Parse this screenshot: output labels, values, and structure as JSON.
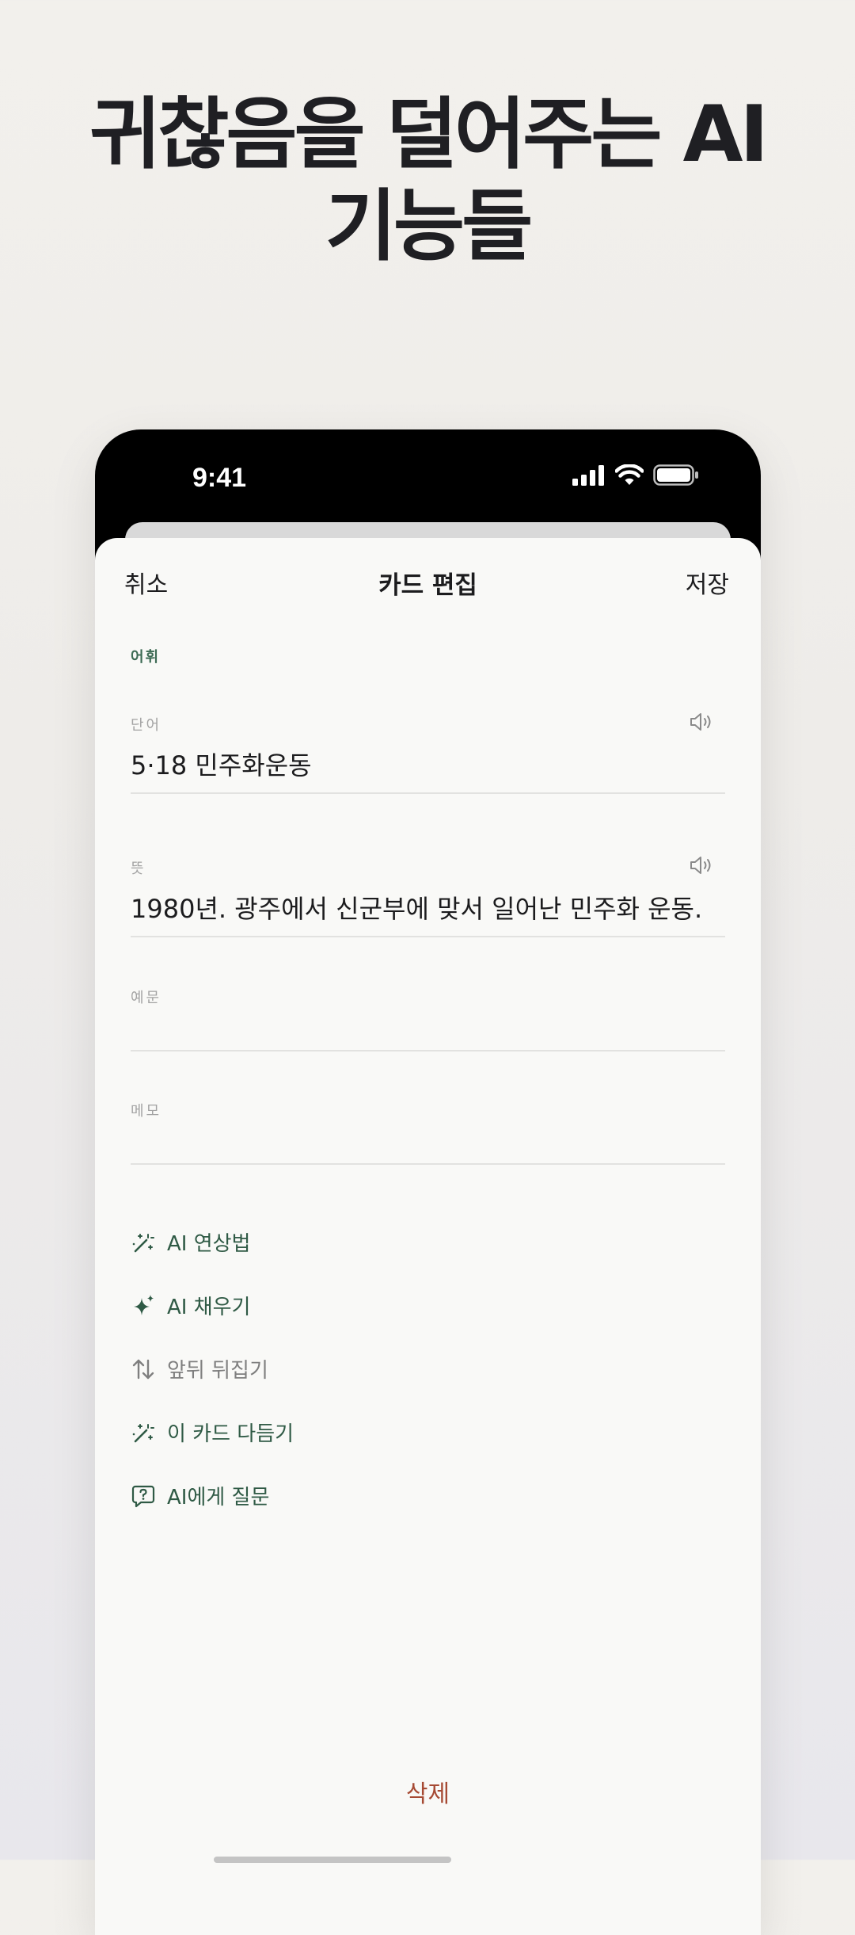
{
  "headline": {
    "line1": "귀찮음을 덜어주는 AI",
    "line2": "기능들"
  },
  "status_bar": {
    "time": "9:41",
    "icons": [
      "cellular-signal-icon",
      "wifi-icon",
      "battery-icon"
    ]
  },
  "nav": {
    "cancel_label": "취소",
    "title": "카드 편집",
    "save_label": "저장"
  },
  "section_label": "어휘",
  "fields": {
    "word": {
      "label": "단어",
      "value": "5·18 민주화운동",
      "icon": "speaker-icon"
    },
    "meaning": {
      "label": "뜻",
      "value": "1980년. 광주에서 신군부에 맞서 일어난 민주화 운동.",
      "icon": "speaker-icon"
    },
    "example": {
      "label": "예문",
      "value": ""
    },
    "memo": {
      "label": "메모",
      "value": ""
    }
  },
  "actions": [
    {
      "label": "AI 연상법",
      "icon": "magic-wand-icon",
      "color": "#2f5a45"
    },
    {
      "label": "AI 채우기",
      "icon": "sparkles-icon",
      "color": "#2f5a45"
    },
    {
      "label": "앞뒤 뒤집기",
      "icon": "swap-vertical-icon",
      "color": "#7f7f7f"
    },
    {
      "label": "이 카드 다듬기",
      "icon": "magic-wand-icon",
      "color": "#2f5a45"
    },
    {
      "label": "AI에게 질문",
      "icon": "question-bubble-icon",
      "color": "#2f5a45"
    }
  ],
  "delete_label": "삭제",
  "colors": {
    "accent_green": "#2f5a45",
    "delete_red": "#a64a34",
    "sheet_bg": "#f9f9f7"
  }
}
